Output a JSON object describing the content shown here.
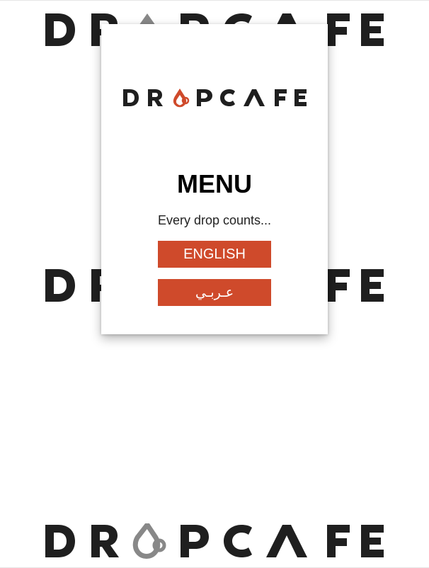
{
  "brand": {
    "logo_text": "DROPCAFE",
    "icon": "drop-cup-icon",
    "logo_color": "#1f1f1f",
    "bg_icon_color": "#888888",
    "accent": "#cf4a2b"
  },
  "menu": {
    "title": "MENU",
    "tagline": "Every drop counts..."
  },
  "languages": {
    "english_label": "ENGLISH",
    "arabic_label": "عـربـي"
  },
  "colors": {
    "button_bg": "#cf4a2b",
    "button_text": "#ffffff",
    "card_bg": "#ffffff",
    "page_bg": "#ffffff"
  }
}
